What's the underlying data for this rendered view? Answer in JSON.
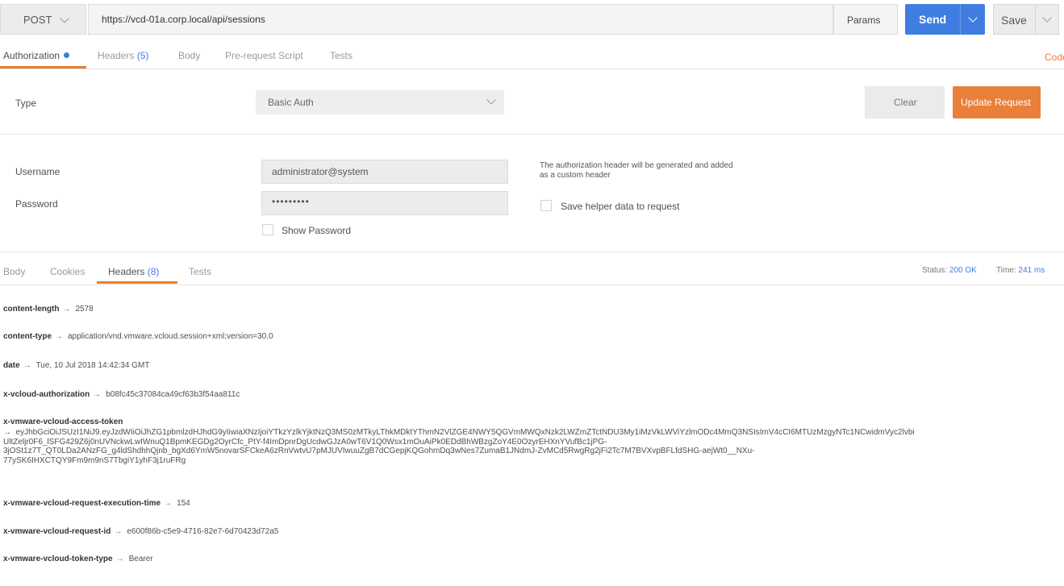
{
  "request": {
    "method": "POST",
    "url": "https://vcd-01a.corp.local/api/sessions",
    "params_label": "Params",
    "send_label": "Send",
    "save_label": "Save"
  },
  "request_tabs": {
    "authorization": "Authorization",
    "headers": "Headers",
    "headers_count": "(5)",
    "body": "Body",
    "prerequest": "Pre-request Script",
    "tests": "Tests",
    "code": "Code"
  },
  "auth": {
    "type_label": "Type",
    "type_value": "Basic Auth",
    "clear_label": "Clear",
    "update_label": "Update Request",
    "username_label": "Username",
    "username_value": "administrator@system",
    "password_label": "Password",
    "password_value": "•••••••••",
    "show_password_label": "Show Password",
    "note": "The authorization header will be generated and added as a custom header",
    "save_helper_label": "Save helper data to request"
  },
  "response_tabs": {
    "body": "Body",
    "cookies": "Cookies",
    "headers": "Headers",
    "headers_count": "(8)",
    "tests": "Tests"
  },
  "status": {
    "status_label": "Status:",
    "status_value": "200 OK",
    "time_label": "Time:",
    "time_value": "241 ms"
  },
  "arrow": "→",
  "headers": [
    {
      "key": "content-length",
      "value": "2578"
    },
    {
      "key": "content-type",
      "value": "application/vnd.vmware.vcloud.session+xml;version=30.0"
    },
    {
      "key": "date",
      "value": "Tue, 10 Jul 2018 14:42:34 GMT"
    },
    {
      "key": "x-vcloud-authorization",
      "value": "b08fc45c37084ca49cf63b3f54aa811c"
    },
    {
      "key": "x-vmware-vcloud-access-token",
      "value": "→  eyJhbGciOiJSUzI1NiJ9.eyJzdWIiOiJhZG1pbmlzdHJhdG9yIiwiaXNzIjoiYTkzYzlkYjktNzQ3MS0zMTkyLThkMDktYThmN2VlZGE4NWY5QGVmMWQxNzk2LWZmZTctNDU3My1iMzVkLWViYzlmODc4MmQ3NSIsImV4cCI6MTUzMzgyNTc1NCwidmVyc2lvbi\nUltZeljr0F6_lSFG429Z6j0nUVNckwLwIWnuQ1BpmKEGDg2OyrCfc_PtY-f4ImDpnrDgUcdwGJzA0wT6V1Q0Wsx1mOuAiPk0EDdBhWBzgZoY4E0OzyrEHXnYVufBc1jPG-\n3jOSt1z7T_QT0LDa2ANzFG_g4ldShdhhQjnb_bgXd6YmW5novarSFCkeA6zRnVwtvU7pMJUVIwuuZgB7dCGepjKQGohmDq3wNes7ZumaB1JNdmJ-ZvMCd5RwgRg2jFi2Tc7M7BVXvpBFLfdSHG-aejWt0__NXu-\n77ySK6IHXCTQY9Fm9m9nS7TbgiY1yhF3j1ruFRg"
    },
    {
      "key": "x-vmware-vcloud-request-execution-time",
      "value": "154"
    },
    {
      "key": "x-vmware-vcloud-request-id",
      "value": "e600f86b-c5e9-4716-82e7-6d70423d72a5"
    },
    {
      "key": "x-vmware-vcloud-token-type",
      "value": "Bearer"
    }
  ],
  "colors": {
    "accent_blue": "#3f7ee0",
    "accent_orange": "#f07d2a"
  }
}
